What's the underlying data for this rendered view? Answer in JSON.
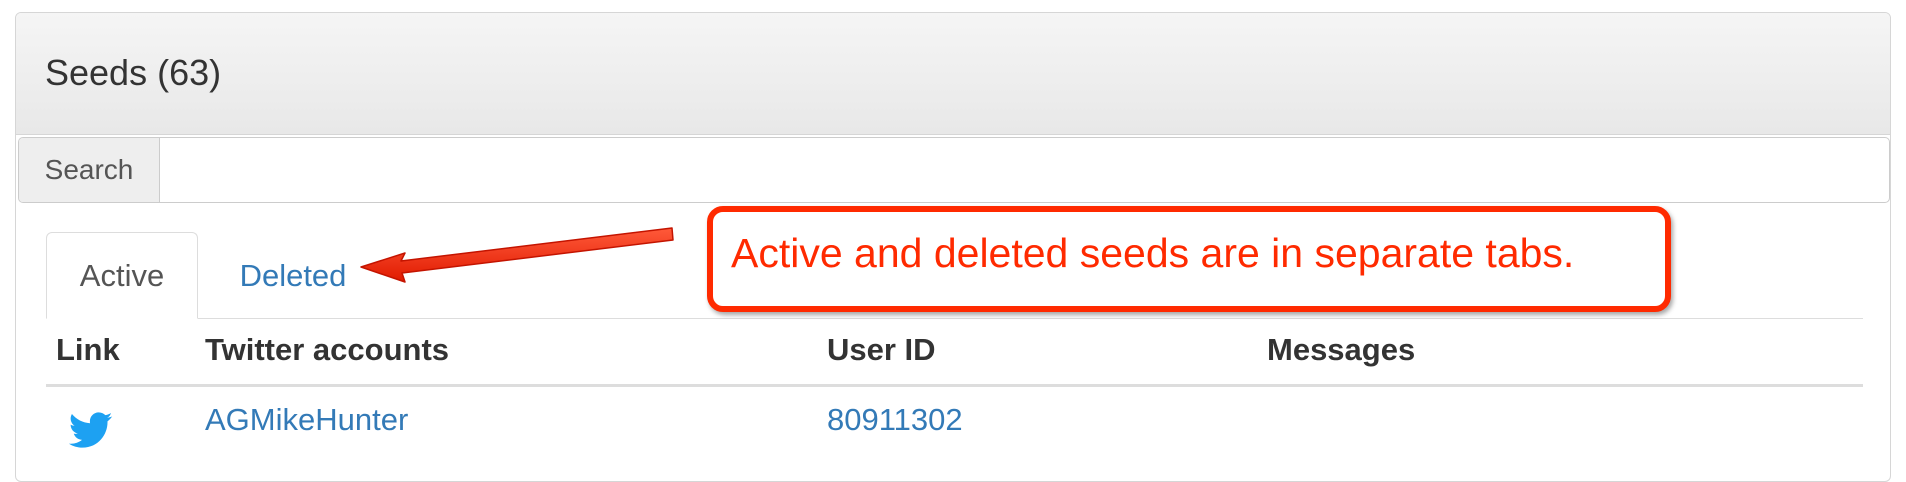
{
  "panel": {
    "title": "Seeds (63)"
  },
  "search": {
    "label": "Search",
    "value": ""
  },
  "tabs": [
    {
      "label": "Active",
      "active": true
    },
    {
      "label": "Deleted",
      "active": false
    }
  ],
  "table": {
    "columns": [
      "Link",
      "Twitter accounts",
      "User ID",
      "Messages"
    ],
    "rows": [
      {
        "link_icon": "twitter-icon",
        "account": "AGMikeHunter",
        "user_id": "80911302",
        "messages": ""
      }
    ]
  },
  "annotation": {
    "text": "Active and deleted seeds are in separate tabs."
  },
  "colors": {
    "link": "#337ab7",
    "annotation": "#ff2a00",
    "twitter": "#1da1f2"
  }
}
